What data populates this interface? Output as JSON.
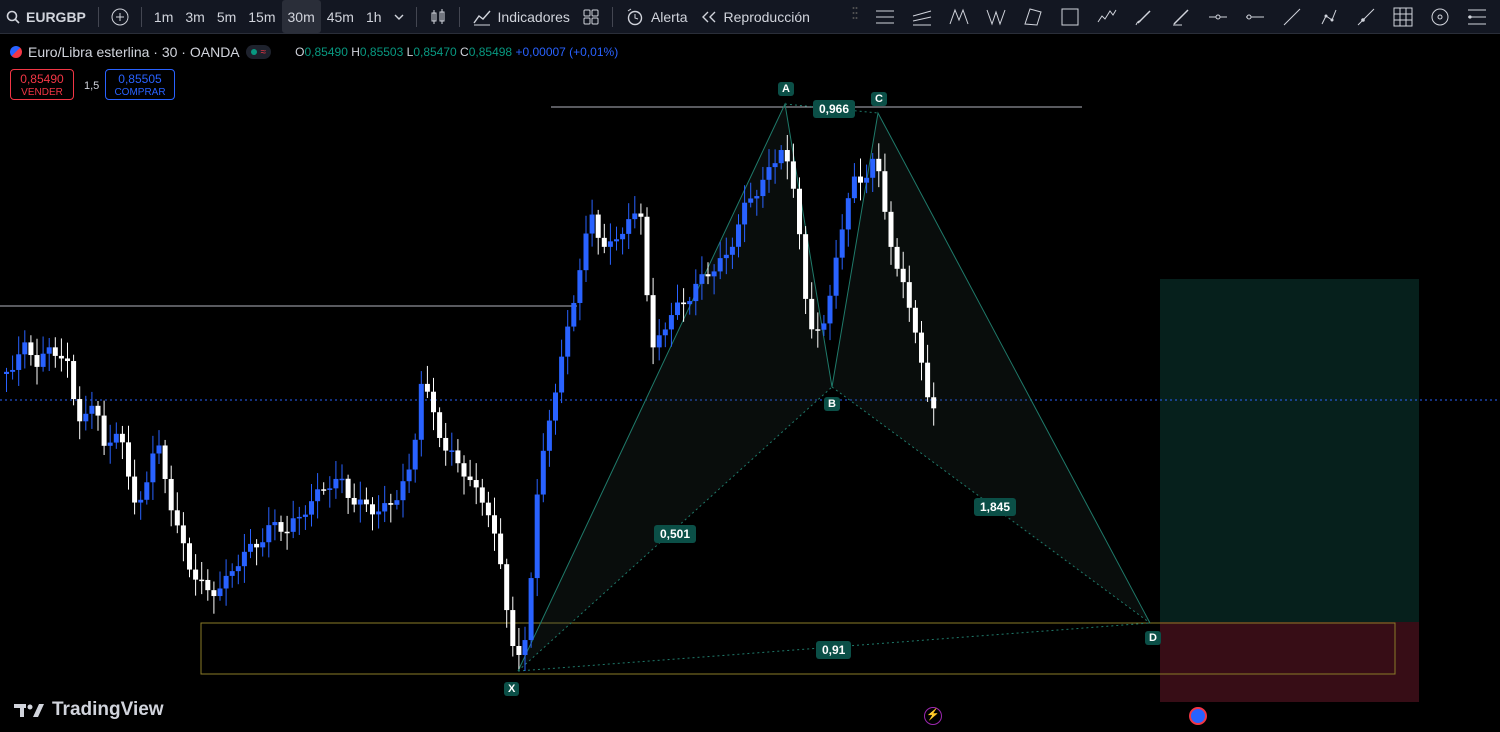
{
  "toolbar": {
    "symbol": "EURGBP",
    "intervals": [
      "1m",
      "3m",
      "5m",
      "15m",
      "30m",
      "45m",
      "1h"
    ],
    "active_interval": "30m",
    "indicators_label": "Indicadores",
    "alert_label": "Alerta",
    "replay_label": "Reproducción"
  },
  "legend": {
    "title": "Euro/Libra esterlina · 30 · OANDA",
    "open_label": "O",
    "open": "0,85490",
    "high_label": "H",
    "high": "0,85503",
    "low_label": "L",
    "low": "0,85470",
    "close_label": "C",
    "close": "0,85498",
    "change": "+0,00007 (+0,01%)"
  },
  "trade": {
    "sell_price": "0,85490",
    "sell_label": "VENDER",
    "spread": "1,5",
    "buy_price": "0,85505",
    "buy_label": "COMPRAR"
  },
  "pattern": {
    "points": [
      "X",
      "A",
      "B",
      "C",
      "D"
    ],
    "ratios": [
      "0,966",
      "0,501",
      "1,845",
      "0,91"
    ]
  },
  "brand": "TradingView",
  "colors": {
    "up": "#2962ff",
    "down": "#ffffff",
    "pattern": "#0b4f47",
    "profit": "#06201c",
    "loss": "#370d16"
  }
}
